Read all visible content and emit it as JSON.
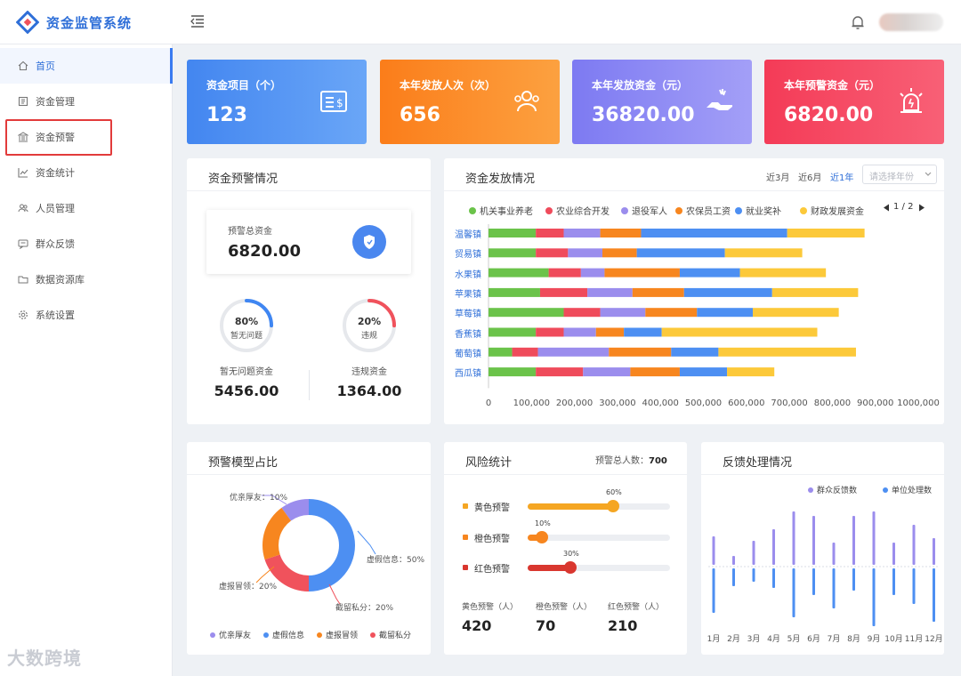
{
  "app": {
    "title": "资金监管系统"
  },
  "sidebar": {
    "items": [
      {
        "label": "首页",
        "icon": "home-icon",
        "active": true
      },
      {
        "label": "资金管理",
        "icon": "ledger-icon"
      },
      {
        "label": "资金预警",
        "icon": "bank-icon"
      },
      {
        "label": "资金统计",
        "icon": "chart-icon"
      },
      {
        "label": "人员管理",
        "icon": "people-icon"
      },
      {
        "label": "群众反馈",
        "icon": "feedback-icon"
      },
      {
        "label": "数据资源库",
        "icon": "folder-icon"
      },
      {
        "label": "系统设置",
        "icon": "gear-icon"
      }
    ],
    "watermark": "大数跨境"
  },
  "stats": [
    {
      "label": "资金项目（个）",
      "value": "123",
      "color": "#4b8ff2",
      "icon": "folder-dollar-icon"
    },
    {
      "label": "本年发放人次（次）",
      "value": "656",
      "color": "#fb8c1f",
      "icon": "people-icon"
    },
    {
      "label": "本年发放资金（元）",
      "value": "36820.00",
      "color": "#8a86f4",
      "icon": "hand-money-icon"
    },
    {
      "label": "本年预警资金（元）",
      "value": "6820.00",
      "color": "#f5465c",
      "icon": "alarm-icon"
    }
  ],
  "warning_panel": {
    "title": "资金预警情况",
    "total_label": "预警总资金",
    "total_value": "6820.00",
    "ring1": {
      "percent": 80,
      "percent_text": "80%",
      "text": "暂无问题",
      "color": "#3f86f2"
    },
    "ring2": {
      "percent": 20,
      "percent_text": "20%",
      "text": "违规",
      "color": "#f0525c"
    },
    "left_label": "暂无问题资金",
    "left_value": "5456.00",
    "right_label": "违规资金",
    "right_value": "1364.00"
  },
  "issue_panel": {
    "title": "资金发放情况",
    "filters": [
      "近3月",
      "近6月",
      "近1年"
    ],
    "active_filter": "近1年",
    "select_placeholder": "请选择年份",
    "pager": "1 / 2"
  },
  "chart_data": [
    {
      "type": "bar",
      "orientation": "horizontal",
      "stacked": true,
      "categories": [
        "温馨镇",
        "贸易镇",
        "水果镇",
        "苹果镇",
        "草莓镇",
        "香蕉镇",
        "葡萄镇",
        "西瓜镇"
      ],
      "series": [
        {
          "name": "机关事业养老",
          "color": "#6bc34a",
          "values": [
            110000,
            110000,
            140000,
            120000,
            175000,
            110000,
            55000,
            110000
          ]
        },
        {
          "name": "农业综合开发",
          "color": "#ef4b5b",
          "values": [
            65000,
            75000,
            75000,
            110000,
            85000,
            65000,
            60000,
            110000
          ]
        },
        {
          "name": "退役军人",
          "color": "#9b8ded",
          "values": [
            85000,
            80000,
            55000,
            105000,
            105000,
            75000,
            165000,
            110000
          ]
        },
        {
          "name": "农保员工资",
          "color": "#f7861f",
          "values": [
            95000,
            80000,
            175000,
            120000,
            120000,
            65000,
            145000,
            115000
          ]
        },
        {
          "name": "就业奖补",
          "color": "#4d8ff2",
          "values": [
            340000,
            205000,
            140000,
            205000,
            130000,
            88000,
            110000,
            110000
          ]
        },
        {
          "name": "财政发展资金",
          "color": "#fcc93a",
          "values": [
            180000,
            180000,
            200000,
            200000,
            200000,
            362000,
            320000,
            110000
          ]
        }
      ],
      "xlim": [
        0,
        1000000
      ],
      "xticks": [
        "0",
        "100,000",
        "200,000",
        "300,000",
        "400,000",
        "500,000",
        "600,000",
        "700,000",
        "800,000",
        "900,000",
        "1000,000"
      ]
    },
    {
      "type": "pie",
      "donut": true,
      "title": "预警模型占比",
      "slices": [
        {
          "name": "优亲厚友",
          "value": 10,
          "label": "优亲厚友：10%",
          "color": "#9b8ded"
        },
        {
          "name": "虚假信息",
          "value": 50,
          "label": "虚假信息：50%",
          "color": "#4d8ff2"
        },
        {
          "name": "截留私分",
          "value": 20,
          "label": "截留私分：20%",
          "color": "#f0525c"
        },
        {
          "name": "虚报冒领",
          "value": 20,
          "label": "虚报冒领：20%",
          "color": "#f7861f"
        }
      ],
      "legend": [
        "优亲厚友",
        "虚假信息",
        "虚报冒领",
        "截留私分"
      ]
    },
    {
      "type": "bar",
      "title": "反馈处理情况",
      "categories": [
        "1月",
        "2月",
        "3月",
        "4月",
        "5月",
        "6月",
        "7月",
        "8月",
        "9月",
        "10月",
        "11月",
        "12月"
      ],
      "series": [
        {
          "name": "群众反馈数",
          "color": "#9b8ded",
          "values": [
            32,
            10,
            27,
            40,
            60,
            55,
            25,
            55,
            60,
            25,
            45,
            30
          ]
        },
        {
          "name": "单位处理数",
          "color": "#4d8ff2",
          "values": [
            -50,
            -20,
            -15,
            -22,
            -55,
            -30,
            -45,
            -25,
            -65,
            -30,
            -40,
            -60
          ]
        }
      ]
    }
  ],
  "risk_panel": {
    "title": "风险统计",
    "total_label": "预警总人数：",
    "total_value": "700",
    "bars": [
      {
        "label": "黄色预警",
        "percent": 60,
        "percent_text": "60%",
        "color": "#f5a623"
      },
      {
        "label": "橙色预警",
        "percent": 10,
        "percent_text": "10%",
        "color": "#f7861f"
      },
      {
        "label": "红色预警",
        "percent": 30,
        "percent_text": "30%",
        "color": "#d9372f"
      }
    ],
    "counts": [
      {
        "label": "黄色预警（人）",
        "value": "420"
      },
      {
        "label": "橙色预警（人）",
        "value": "70"
      },
      {
        "label": "红色预警（人）",
        "value": "210"
      }
    ]
  }
}
